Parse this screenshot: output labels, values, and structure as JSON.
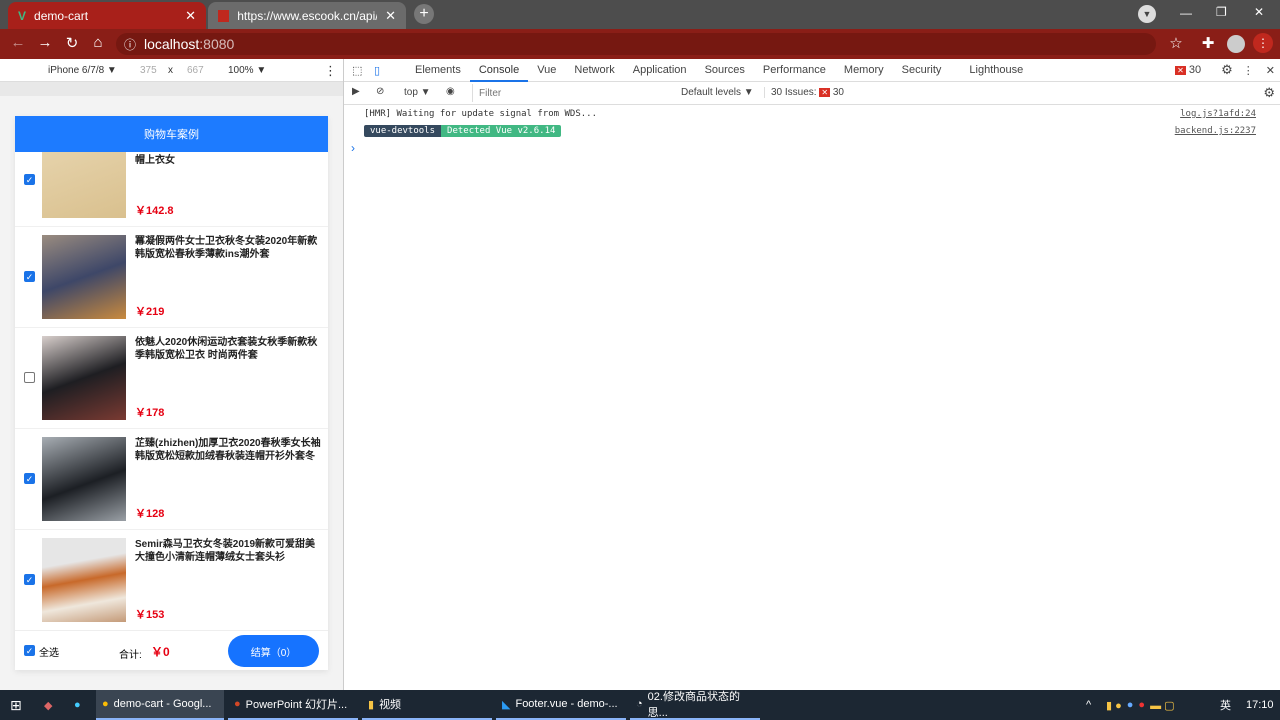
{
  "browser": {
    "tabs": [
      {
        "title": "demo-cart",
        "active": true
      },
      {
        "title": "https://www.escook.cn/api/ca",
        "active": false
      }
    ],
    "url_host": "localhost",
    "url_port": ":8080"
  },
  "device": {
    "name": "iPhone 6/7/8 ▼",
    "width": "375",
    "x": "x",
    "height": "667",
    "zoom": "100% ▼"
  },
  "devtools": {
    "tabs": [
      "Elements",
      "Console",
      "Vue",
      "Network",
      "Application",
      "Sources",
      "Performance",
      "Memory",
      "Security",
      "Lighthouse"
    ],
    "active_tab": "Console",
    "error_count": "30",
    "context": "top ▼",
    "filter_placeholder": "Filter",
    "levels": "Default levels ▼",
    "issues_label": "30 Issues:",
    "issues_count": "30",
    "logs": [
      {
        "text": "[HMR] Waiting for update signal from WDS...",
        "source": "log.js?1afd:24"
      },
      {
        "badge1": "vue-devtools",
        "badge2": "Detected Vue v2.6.14",
        "source": "backend.js:2237"
      }
    ],
    "prompt": "›"
  },
  "cart": {
    "header": "购物车案例",
    "items": [
      {
        "title": "帽上衣女",
        "price": "￥142.8",
        "checked": true
      },
      {
        "title": "冪凝假两件女士卫衣秋冬女装2020年新款韩版宽松春秋季薄款ins潮外套",
        "price": "￥219",
        "checked": true
      },
      {
        "title": "依魅人2020休闲运动衣套装女秋季新款秋季韩版宽松卫衣 时尚两件套",
        "price": "￥178",
        "checked": false
      },
      {
        "title": "芷臻(zhizhen)加厚卫衣2020春秋季女长袖韩版宽松短款加绒春秋装连帽开衫外套冬",
        "price": "￥128",
        "checked": true
      },
      {
        "title": "Semir森马卫衣女冬装2019新款可爱甜美大撞色小清新连帽薄绒女士套头衫",
        "price": "￥153",
        "checked": true
      }
    ],
    "select_all": "全选",
    "total_label": "合计:",
    "total": "￥0",
    "checkout": "结算（0）"
  },
  "taskbar": {
    "apps": [
      "demo-cart - Googl...",
      "PowerPoint 幻灯片...",
      "视频",
      "Footer.vue - demo-...",
      "02.修改商品状态的思..."
    ],
    "ime": "英",
    "time": "17:10"
  },
  "colors": {
    "accent": "#1d7bff",
    "price": "#e60012",
    "browser": "#8a1e17"
  }
}
